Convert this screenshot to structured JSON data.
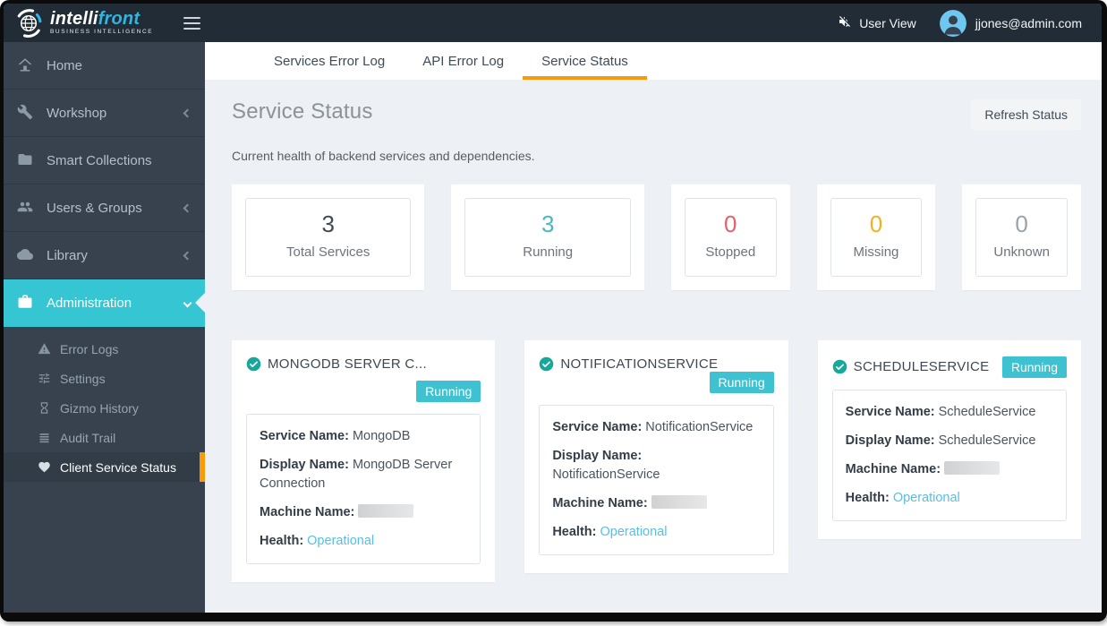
{
  "topbar": {
    "logo": {
      "part1": "intelli",
      "part2": "front",
      "tagline": "BUSINESS INTELLIGENCE"
    },
    "user_view_label": "User View",
    "user_email": "jjones@admin.com"
  },
  "sidebar": {
    "items": [
      {
        "label": "Home",
        "icon": "home-icon"
      },
      {
        "label": "Workshop",
        "icon": "wrench-icon",
        "chevron": "left"
      },
      {
        "label": "Smart Collections",
        "icon": "folder-icon"
      },
      {
        "label": "Users & Groups",
        "icon": "users-icon",
        "chevron": "left"
      },
      {
        "label": "Library",
        "icon": "cloud-icon",
        "chevron": "left"
      },
      {
        "label": "Administration",
        "icon": "briefcase-icon",
        "chevron": "down",
        "active": true
      }
    ],
    "admin_submenu": [
      {
        "label": "Error Logs",
        "icon": "warning-icon"
      },
      {
        "label": "Settings",
        "icon": "sliders-icon"
      },
      {
        "label": "Gizmo History",
        "icon": "hourglass-icon"
      },
      {
        "label": "Audit Trail",
        "icon": "list-icon"
      },
      {
        "label": "Client Service Status",
        "icon": "heart-pulse-icon",
        "active": true
      }
    ]
  },
  "tabs": [
    {
      "label": "Services Error Log"
    },
    {
      "label": "API Error Log"
    },
    {
      "label": "Service Status",
      "active": true
    }
  ],
  "page": {
    "title": "Service Status",
    "subtitle": "Current health of backend services and dependencies.",
    "refresh_button_label": "Refresh Status"
  },
  "stats": [
    {
      "value": "3",
      "label": "Total Services",
      "color": "#3e4a56"
    },
    {
      "value": "3",
      "label": "Running",
      "color": "#47b9c1"
    },
    {
      "value": "0",
      "label": "Stopped",
      "color": "#e4606d"
    },
    {
      "value": "0",
      "label": "Missing",
      "color": "#eeb222"
    },
    {
      "value": "0",
      "label": "Unknown",
      "color": "#99a3ac"
    }
  ],
  "service_field_labels": {
    "service_name": "Service Name:",
    "display_name": "Display Name:",
    "machine_name": "Machine Name:",
    "health": "Health:"
  },
  "services": [
    {
      "title": "MONGODB SERVER C...",
      "status_badge": "Running",
      "service_name": "MongoDB",
      "display_name": "MongoDB Server Connection",
      "health": "Operational"
    },
    {
      "title": "NOTIFICATIONSERVICE",
      "status_badge": "Running",
      "service_name": "NotificationService",
      "display_name": "NotificationService",
      "health": "Operational"
    },
    {
      "title": "SCHEDULESERVICE",
      "status_badge": "Running",
      "service_name": "ScheduleService",
      "display_name": "ScheduleService",
      "health": "Operational"
    }
  ],
  "colors": {
    "topbar_bg": "#222c37",
    "sidebar_bg": "#37424e",
    "active_item_cyan": "#36c6d3",
    "accent_orange": "#f79b0d",
    "badge_teal": "#3ec1d0",
    "check_circle_teal": "#17a79b",
    "health_blue": "#54c0e8",
    "content_bg": "#edf0f4"
  }
}
